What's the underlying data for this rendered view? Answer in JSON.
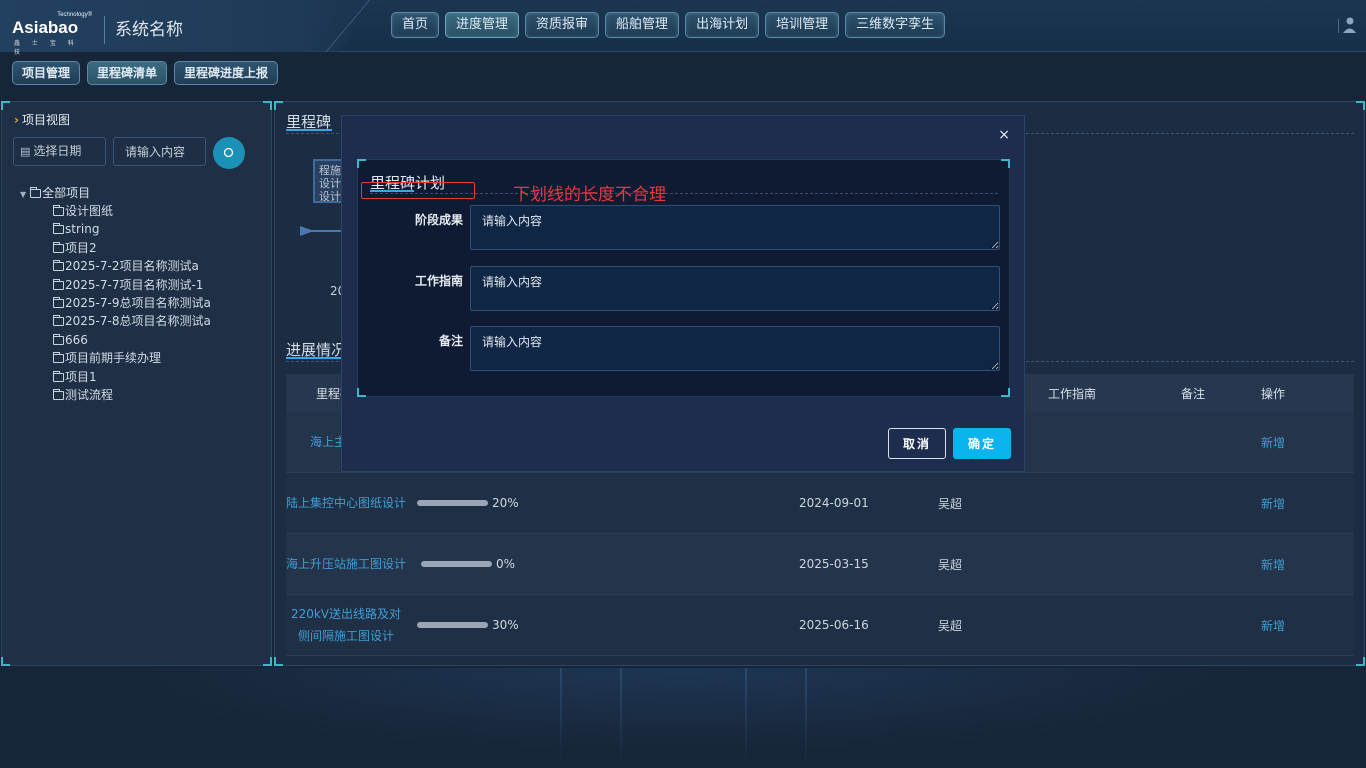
{
  "header": {
    "logo": {
      "tech_text": "Technology®",
      "brand_text": "Asiabao",
      "sub_text": "鑫 士 宝 科 技"
    },
    "system_name": "系统名称",
    "nav": [
      {
        "label": "首页",
        "active": false
      },
      {
        "label": "进度管理",
        "active": true
      },
      {
        "label": "资质报审",
        "active": false
      },
      {
        "label": "船舶管理",
        "active": false
      },
      {
        "label": "出海计划",
        "active": false
      },
      {
        "label": "培训管理",
        "active": false
      },
      {
        "label": "三维数字孪生",
        "active": false
      }
    ]
  },
  "subnav": [
    {
      "label": "项目管理",
      "active": false
    },
    {
      "label": "里程碑清单",
      "active": true
    },
    {
      "label": "里程碑进度上报",
      "active": false
    }
  ],
  "left": {
    "title": "项目视图",
    "date_placeholder": "选择日期",
    "search_placeholder": "请输入内容",
    "tree_root": "全部项目",
    "tree_items": [
      "设计图纸",
      "string",
      "项目2",
      "2025-7-2项目名称测试a",
      "2025-7-7项目名称测试-1",
      "2025-7-9总项目名称测试a",
      "2025-7-8总项目名称测试a",
      "666",
      "项目前期手续办理",
      "项目1",
      "测试流程"
    ]
  },
  "main": {
    "milestone_title": "里程碑",
    "milestone_card_text": "程施设计设计",
    "milestone_date_partial": "20",
    "progress_title": "进展情况",
    "table": {
      "headers": {
        "milestone": "里程碑",
        "guide": "工作指南",
        "note": "备注",
        "action": "操作"
      },
      "rows": [
        {
          "name": "海上主体图纸",
          "progress": 0,
          "progress_text": "",
          "date": "",
          "person": "",
          "action": "新增"
        },
        {
          "name": "陆上集控中心图纸设计",
          "progress": 0.2,
          "progress_text": "20%",
          "date": "2024-09-01",
          "person": "吴超",
          "action": "新增"
        },
        {
          "name": "海上升压站施工图设计",
          "progress": 0,
          "progress_text": "0%",
          "date": "2025-03-15",
          "person": "吴超",
          "action": "新增"
        },
        {
          "name": "220kV送出线路及对侧间隔施工图设计",
          "progress": 0.3,
          "progress_text": "30%",
          "date": "2025-06-16",
          "person": "吴超",
          "action": "新增"
        }
      ]
    }
  },
  "modal": {
    "close": "×",
    "title": "里程碑计划",
    "fields": [
      {
        "label": "阶段成果",
        "placeholder": "请输入内容"
      },
      {
        "label": "工作指南",
        "placeholder": "请输入内容"
      },
      {
        "label": "备注",
        "placeholder": "请输入内容"
      }
    ],
    "cancel_label": "取消",
    "ok_label": "确定"
  },
  "annotation": {
    "text": "下划线的长度不合理"
  },
  "colors": {
    "accent": "#0bb4ee",
    "link": "#3f9fd3",
    "corner": "#3fb5c9",
    "annotation": "#e53a3a"
  }
}
